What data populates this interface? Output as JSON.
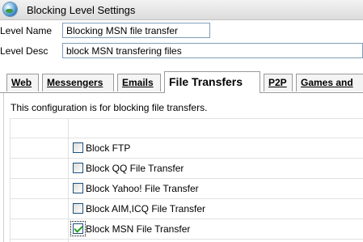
{
  "window": {
    "title": "Blocking Level Settings",
    "icon": "globe-icon"
  },
  "fields": {
    "name_label": "Level Name",
    "name_value": "Blocking MSN file transfer",
    "desc_label": "Level Desc",
    "desc_value": "block MSN transfering files"
  },
  "tabs": [
    {
      "label": "Web",
      "active": false
    },
    {
      "label": "Messengers",
      "active": false
    },
    {
      "label": "Emails",
      "active": false
    },
    {
      "label": "File Transfers",
      "active": true
    },
    {
      "label": "P2P",
      "active": false
    },
    {
      "label": "Games and",
      "active": false
    }
  ],
  "content": {
    "info": "This configuration is for blocking file transfers.",
    "options": [
      {
        "label": "Block FTP",
        "checked": false
      },
      {
        "label": "Block QQ File Transfer",
        "checked": false
      },
      {
        "label": "Block Yahoo! File Transfer",
        "checked": false
      },
      {
        "label": "Block AIM,ICQ File Transfer",
        "checked": false
      },
      {
        "label": "Block MSN File Transfer",
        "checked": true
      }
    ]
  },
  "colors": {
    "check": "#21a121",
    "input_border": "#7f9db9"
  }
}
